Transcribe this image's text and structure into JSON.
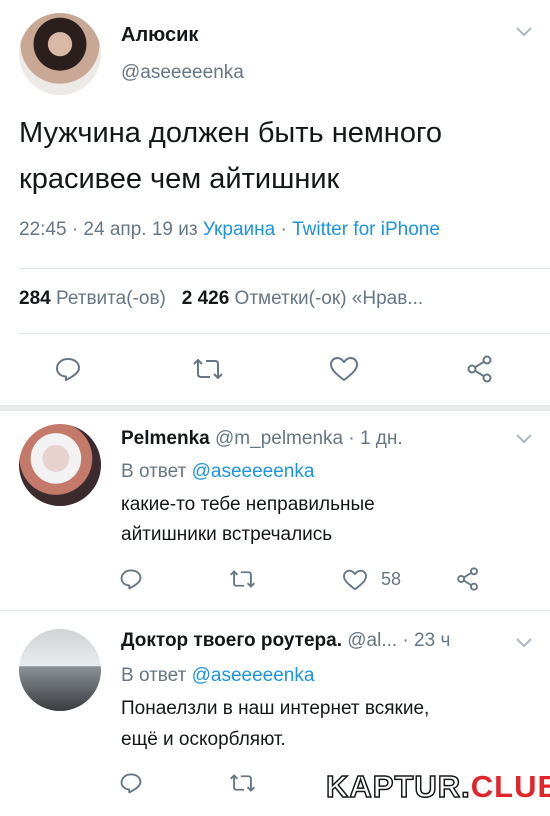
{
  "main_tweet": {
    "display_name": "Алюсик",
    "handle": "@aseeeeenka",
    "text_line1": "Мужчина должен быть немного",
    "text_line2": "красивее чем айтишник",
    "time_date": "22:45 · 24 апр. 19 из ",
    "location": "Украина",
    "separator": " · ",
    "source": "Twitter for iPhone",
    "retweets_count": "284",
    "retweets_label": "Ретвита(-ов)",
    "likes_count": "2 426",
    "likes_label": "Отметки(-ок) «Нрав..."
  },
  "replies": [
    {
      "display_name": "Pelmenka",
      "handle_time": "@m_pelmenka · 1 дн.",
      "reply_to_prefix": "В ответ ",
      "reply_to_handle": "@aseeeeenka",
      "text_line1": "какие-то тебе неправильные",
      "text_line2": "айтишники встречались",
      "likes": "58"
    },
    {
      "display_name": "Доктор твоего роутера.",
      "handle_time": "@al... · 23 ч",
      "reply_to_prefix": "В ответ ",
      "reply_to_handle": "@aseeeeenka",
      "text_line1": "Понаелзли в наш интернет всякие,",
      "text_line2": "ещё и оскорбляют."
    }
  ],
  "watermark": {
    "part1": "KAPTUR.",
    "part2": "CLUB"
  },
  "colors": {
    "text": "#14171a",
    "muted": "#657786",
    "link": "#1b95e0",
    "icon": "#657786",
    "divider": "#e1e8ed",
    "watermark_red": "#e0262b"
  }
}
